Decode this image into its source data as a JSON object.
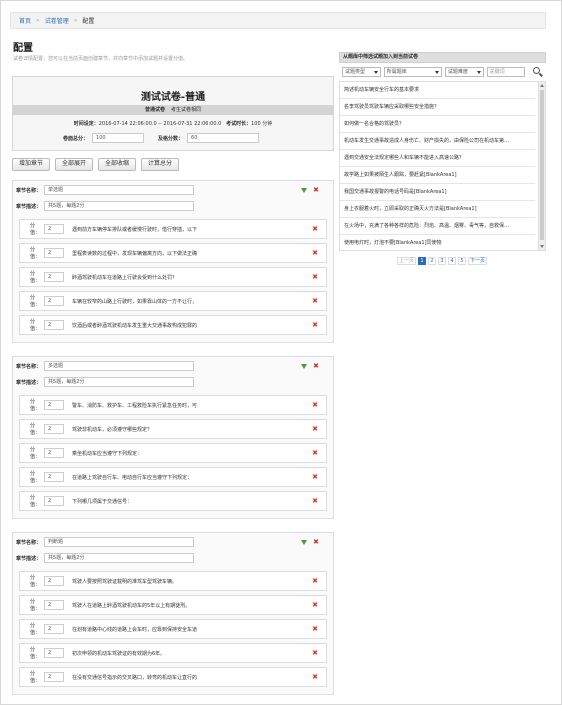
{
  "breadcrumb": {
    "home": "首页",
    "manage": "试卷管理",
    "current": "配置"
  },
  "page": {
    "title": "配置",
    "desc": "试卷详情配置，您可以在当前页面创建章节，并向章节中添加试题并设置分值。"
  },
  "paper": {
    "title": "测试试卷-普通",
    "type_label": "普通试卷",
    "type_note": "考生试卷相同",
    "time_label": "时间设定：",
    "time_value": "2016-07-14 22:06:00.0 -- 2016-07-31 22:06:00.0",
    "duration_label": "考试时长：",
    "duration_value": "100 分钟",
    "total_label": "卷面总分：",
    "total_value": "100",
    "pass_label": "及格分数：",
    "pass_value": "60"
  },
  "toolbar": {
    "add": "增加章节",
    "expand": "全部展开",
    "collapse": "全部收缩",
    "calc": "计算总分"
  },
  "labels": {
    "chapter_name": "章节名称：",
    "chapter_desc": "章节描述：",
    "score": "分值："
  },
  "sections": [
    {
      "name": "单选题",
      "desc": "共5题，每题2分",
      "questions": [
        {
          "score": "2",
          "text": "遇到前方车辆停车排队或者缓慢行驶时，借行穿插，以下"
        },
        {
          "score": "2",
          "text": "里程表读数的过程中，发现车辆偏离方向，以下做法正确"
        },
        {
          "score": "2",
          "text": "醉酒驾驶机动车在道路上行驶会受到什么处罚？"
        },
        {
          "score": "2",
          "text": "车辆在较窄的山路上行驶时，如果靠山体的一方不让行，"
        },
        {
          "score": "2",
          "text": "饮酒后或者醉酒驾驶机动车发生重大交通事故构成犯罪的"
        }
      ]
    },
    {
      "name": "多选题",
      "desc": "共5题，每题2分",
      "questions": [
        {
          "score": "2",
          "text": "警车、消防车、救护车、工程救险车执行紧急任务时，可"
        },
        {
          "score": "2",
          "text": "驾驶非机动车，必须遵守哪些规定？"
        },
        {
          "score": "2",
          "text": "乘坐机动车应当遵守下列规定："
        },
        {
          "score": "2",
          "text": "在道路上驾驶自行车、电动自行车应当遵守下列规定："
        },
        {
          "score": "2",
          "text": "下列哪几项属于交通信号："
        }
      ]
    },
    {
      "name": "判断题",
      "desc": "共5题，每题2分",
      "questions": [
        {
          "score": "2",
          "text": "驾驶人要按照驾驶证载明的准驾车型驾驶车辆。"
        },
        {
          "score": "2",
          "text": "驾驶人在道路上醉酒驾驶机动车的5年以上有期徒刑。"
        },
        {
          "score": "2",
          "text": "在划有道路中心线的道路上会车时，应靠到保持安全车道"
        },
        {
          "score": "2",
          "text": "初次申领的机动车驾驶证的有效期为6年。"
        },
        {
          "score": "2",
          "text": "在没有交通信号指示的交叉路口，转弯的机动车让直行的"
        }
      ]
    }
  ],
  "right": {
    "title": "从题库中筛选试题加入到当前试卷",
    "filter_type": "试题类型",
    "filter_bank": "所属题库",
    "filter_level": "试题难度",
    "keyword_placeholder": "关键词",
    "questions": [
      "简述机动车辆安全行车的基本要求",
      "名李驾驶员驾驶车辆应采取哪些安全措施？",
      "如何做一名合格的驾驶员？",
      "机动车发生交通事故造成人身伤亡、财产损失的，由保险公司在机动车第…",
      "遇到交通安全法规定哪些人和车辆不能进入高速公路？",
      "故学路上如果被陌生人跟踪，要赶紧[BlankArea1]",
      "我国交通事故报警的电话号码是[BlankArea1]",
      "身上衣服着火时，立即采取的正确灭火方法是[BlankArea1]",
      "在火场中，充满了各种各样的危险：烈焰、高温、烟雾、毒气等，自救保…",
      "使用电灯时，灯泡不要[BlankArea1]同使物"
    ],
    "pager": {
      "prev": "上一页",
      "next": "下一页",
      "pages": [
        "1",
        "2",
        "3",
        "4",
        "5"
      ]
    }
  }
}
